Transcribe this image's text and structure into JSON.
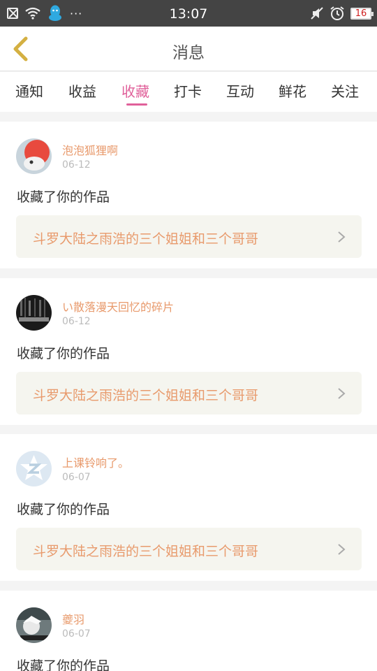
{
  "status_bar": {
    "time": "13:07",
    "more": "···",
    "battery": "16",
    "icons": [
      "close-box-icon",
      "wifi-icon",
      "qq-icon",
      "mute-icon",
      "alarm-icon",
      "battery-icon"
    ]
  },
  "header": {
    "title": "消息",
    "back_icon": "chevron-left-icon"
  },
  "tabs": [
    {
      "label": "通知"
    },
    {
      "label": "收益"
    },
    {
      "label": "收藏"
    },
    {
      "label": "打卡"
    },
    {
      "label": "互动"
    },
    {
      "label": "鲜花"
    },
    {
      "label": "关注"
    }
  ],
  "active_tab": "收藏",
  "colors": {
    "accent": "#e0609a",
    "name": "#e89a6c",
    "back_arrow": "#d4b042"
  },
  "messages": [
    {
      "user": "泡泡狐狸啊",
      "date": "06-12",
      "action": "收藏了你的作品",
      "work": "斗罗大陆之雨浩的三个姐姐和三个哥哥"
    },
    {
      "user": "い散落漫天回忆的碎片",
      "date": "06-12",
      "action": "收藏了你的作品",
      "work": "斗罗大陆之雨浩的三个姐姐和三个哥哥"
    },
    {
      "user": "上课铃响了。",
      "date": "06-07",
      "action": "收藏了你的作品",
      "work": "斗罗大陆之雨浩的三个姐姐和三个哥哥"
    },
    {
      "user": "夔羽",
      "date": "06-07",
      "action": "收藏了你的作品"
    }
  ]
}
